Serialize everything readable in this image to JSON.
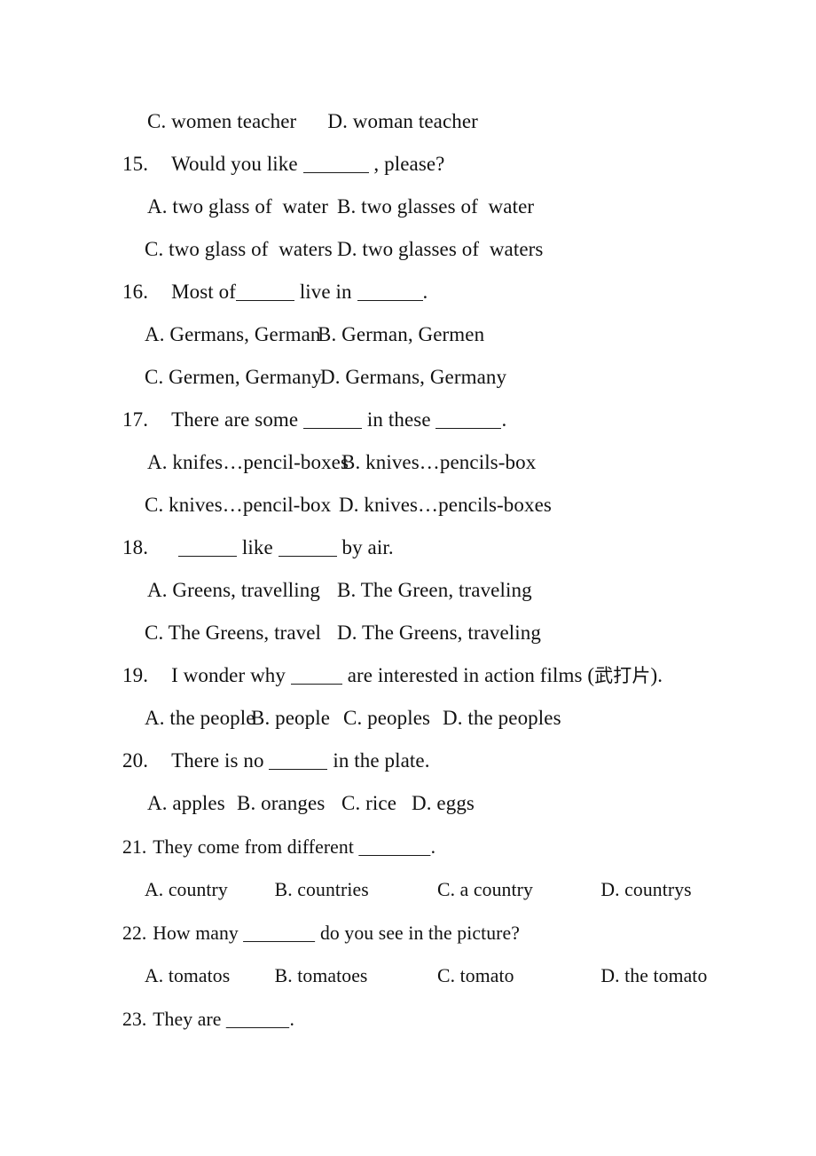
{
  "document": {
    "type": "english-grammar-worksheet",
    "page_background": "#ffffff",
    "text_color": "#111111"
  },
  "lines": {
    "q14_cd": "C. women teacher      D. woman teacher",
    "q15": {
      "number": "15.",
      "text_before": "Would you like ",
      "text_after": " , please?",
      "option_a": "A. two glass of  water",
      "option_b": "B. two glasses of  water",
      "option_c": "C. two glass of  waters",
      "option_d": "D. two glasses of  waters"
    },
    "q16": {
      "number": "16.",
      "text_before": "Most of",
      "text_middle": " live in ",
      "text_after": ".",
      "option_a": "A. Germans, German",
      "option_b": "B. German, Germen",
      "option_c": "C. Germen, Germany",
      "option_d": "D. Germans, Germany"
    },
    "q17": {
      "number": "17.",
      "text_before": "There are some ",
      "text_middle": " in these ",
      "text_after": ".",
      "option_a": "A. knifes…pencil-boxes",
      "option_b": "B. knives…pencils-box",
      "option_c": "C. knives…pencil-box",
      "option_d": "D. knives…pencils-boxes"
    },
    "q18": {
      "number": "18.",
      "text_before": " ",
      "text_middle": " like ",
      "text_after": " by air.",
      "option_a": "A. Greens, travelling",
      "option_b": "B. The Green, traveling",
      "option_c": "C. The Greens, travel",
      "option_d": "D. The Greens, traveling"
    },
    "q19": {
      "number": "19.",
      "text_before": "I wonder why ",
      "text_after": " are interested in action films (",
      "gloss": "武打片",
      "text_end": ").",
      "option_a": "A. the people",
      "option_b": "B. people",
      "option_c": "C. peoples",
      "option_d": "D. the peoples"
    },
    "q20": {
      "number": "20.",
      "text_before": "There is no ",
      "text_after": " in the plate.",
      "option_a": "A. apples",
      "option_b": "B. oranges",
      "option_c": "C. rice",
      "option_d": "D. eggs"
    },
    "q21": {
      "number": "21.",
      "text_before": "They come from different ",
      "text_after": ".",
      "option_a": "A. country",
      "option_b": "B. countries",
      "option_c": "C. a country",
      "option_d": "D. countrys"
    },
    "q22": {
      "number": "22.",
      "text_before": "How many ",
      "text_after": " do you see in the picture?",
      "option_a": "A. tomatos",
      "option_b": "B. tomatoes",
      "option_c": "C. tomato",
      "option_d": "D. the tomato"
    },
    "q23": {
      "number": "23.",
      "text_before": "They are ",
      "text_after": "."
    }
  }
}
